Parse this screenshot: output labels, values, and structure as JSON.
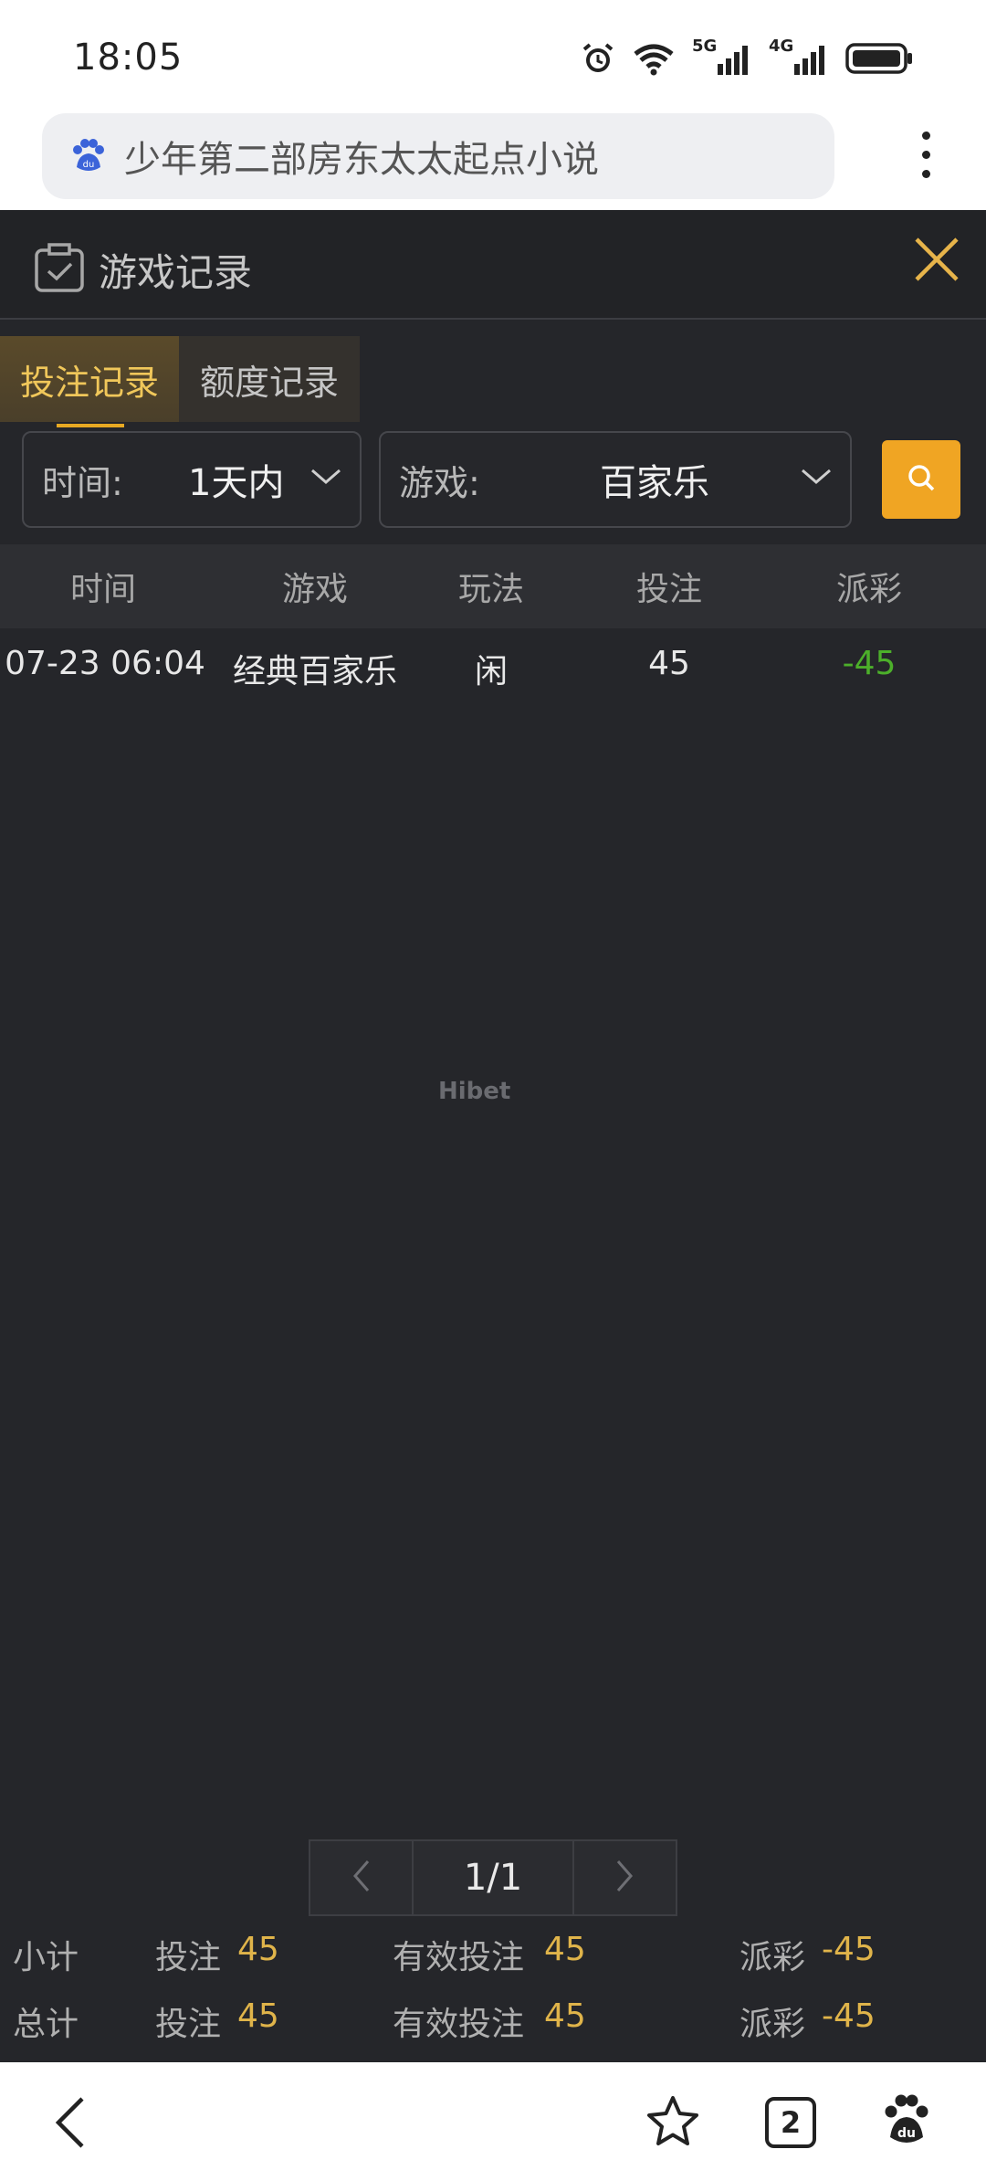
{
  "status": {
    "time": "18:05",
    "network1": "5G",
    "network2": "4G"
  },
  "browser": {
    "url_text": "少年第二部房东太太起点小说",
    "more_icon": "more-vertical-icon",
    "search_engine_icon": "baidu-paw-icon"
  },
  "panel": {
    "title": "游戏记录",
    "icon": "clipboard-check-icon",
    "close_icon": "close-icon",
    "accent_color": "#f0a523"
  },
  "tabs": [
    {
      "label": "投注记录",
      "active": true
    },
    {
      "label": "额度记录",
      "active": false
    }
  ],
  "filters": {
    "time_label": "时间:",
    "time_value": "1天内",
    "game_label": "游戏:",
    "game_value": "百家乐",
    "search_icon": "search-icon"
  },
  "table": {
    "headers": [
      "时间",
      "游戏",
      "玩法",
      "投注",
      "派彩"
    ],
    "rows": [
      {
        "time": "07-23 06:04",
        "game": "经典百家乐",
        "play": "闲",
        "bet": "45",
        "payout": "-45"
      }
    ]
  },
  "watermark": "Hibet",
  "pager": {
    "current": "1/1",
    "prev_icon": "chevron-left-icon",
    "next_icon": "chevron-right-icon"
  },
  "summary": {
    "subtotal": {
      "label": "小计",
      "bet_label": "投注",
      "bet": "45",
      "valid_label": "有效投注",
      "valid": "45",
      "payout_label": "派彩",
      "payout": "-45"
    },
    "total": {
      "label": "总计",
      "bet_label": "投注",
      "bet": "45",
      "valid_label": "有效投注",
      "valid": "45",
      "payout_label": "派彩",
      "payout": "-45"
    }
  },
  "bottom_nav": {
    "back_icon": "back-arrow-icon",
    "star_icon": "star-icon",
    "tabs_count": "2",
    "baidu_icon": "baidu-paw-icon"
  }
}
